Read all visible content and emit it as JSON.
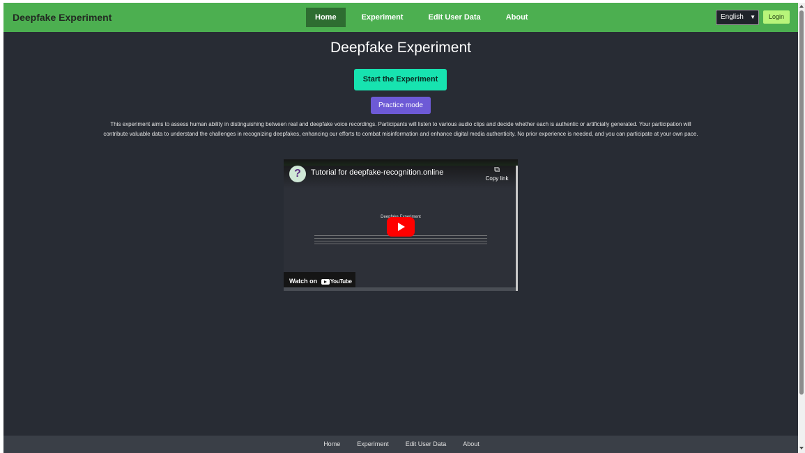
{
  "navbar": {
    "brand": "Deepfake Experiment",
    "links": [
      {
        "label": "Home",
        "active": true
      },
      {
        "label": "Experiment",
        "active": false
      },
      {
        "label": "Edit User Data",
        "active": false
      },
      {
        "label": "About",
        "active": false
      }
    ],
    "language": "English",
    "login_label": "Login"
  },
  "main": {
    "title": "Deepfake Experiment",
    "start_button": "Start the Experiment",
    "practice_button": "Practice mode",
    "description": "This experiment aims to assess human ability in distinguishing between real and deepfake voice recordings. Participants will listen to various audio clips and decide whether each is authentic or artificially generated. Your participation will contribute valuable data to understand the challenges in recognizing deepfakes, enhancing our efforts to combat misinformation and enhance digital media authenticity. No prior experience is needed, and you can participate at your own pace."
  },
  "video": {
    "title": "Tutorial for deepfake-recognition.online",
    "copy_link_label": "Copy link",
    "inner_title": "Deepfake Experiment",
    "watch_on_label": "Watch on",
    "youtube_label": "YouTube"
  },
  "footer": {
    "links": [
      "Home",
      "Experiment",
      "Edit User Data",
      "About"
    ]
  },
  "colors": {
    "navbar": "#4caf50",
    "background": "#282c34",
    "start_button": "#17e3b0",
    "practice_button": "#6d5ad6",
    "login_button": "#b8f57a"
  }
}
